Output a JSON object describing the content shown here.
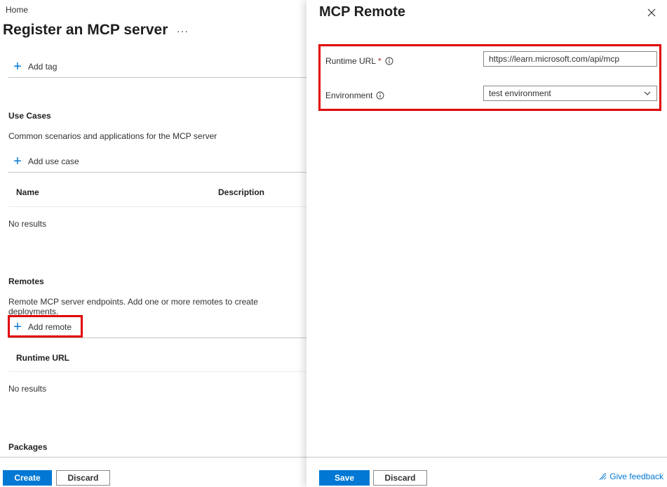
{
  "breadcrumb": {
    "home": "Home"
  },
  "page": {
    "title": "Register an MCP server",
    "more": "···"
  },
  "tags": {
    "add_label": "Add tag"
  },
  "use_cases": {
    "title": "Use Cases",
    "description": "Common scenarios and applications for the MCP server",
    "add_label": "Add use case",
    "columns": [
      "Name",
      "Description"
    ],
    "empty": "No results"
  },
  "remotes": {
    "title": "Remotes",
    "description": "Remote MCP server endpoints. Add one or more remotes to create deployments.",
    "add_label": "Add remote",
    "columns": [
      "Runtime URL"
    ],
    "empty": "No results"
  },
  "packages": {
    "title": "Packages"
  },
  "left_footer": {
    "create": "Create",
    "discard": "Discard"
  },
  "panel": {
    "title": "MCP Remote",
    "runtime_url": {
      "label": "Runtime URL",
      "required": "*",
      "value": "https://learn.microsoft.com/api/mcp"
    },
    "environment": {
      "label": "Environment",
      "value": "test environment"
    },
    "save": "Save",
    "discard": "Discard",
    "feedback": "Give feedback"
  },
  "colors": {
    "accent": "#0078d4",
    "highlight": "#e00000"
  }
}
